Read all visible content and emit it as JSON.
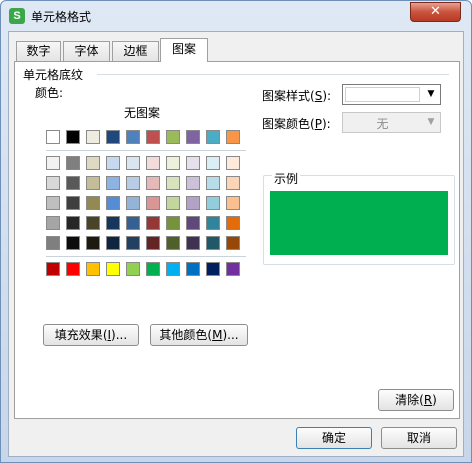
{
  "window": {
    "title": "单元格格式",
    "app_icon_letter": "S",
    "close_glyph": "✕"
  },
  "tabs": [
    {
      "label": "数字",
      "active": false
    },
    {
      "label": "字体",
      "active": false
    },
    {
      "label": "边框",
      "active": false
    },
    {
      "label": "图案",
      "active": true
    }
  ],
  "shading": {
    "group_label": "单元格底纹",
    "color_label": "颜色:",
    "no_pattern": "无图案",
    "palette_rows": [
      [
        "#ffffff",
        "#000000",
        "#eeece1",
        "#1f497d",
        "#4f81bd",
        "#c0504d",
        "#9bbb59",
        "#8064a2",
        "#4bacc6",
        "#f79646"
      ],
      [
        "#f2f2f2",
        "#7f7f7f",
        "#ddd9c3",
        "#c6d9f0",
        "#dbe5f1",
        "#f2dcdb",
        "#ebf1dd",
        "#e5e0ec",
        "#dbeef3",
        "#fdeada"
      ],
      [
        "#d8d8d8",
        "#595959",
        "#c4bd97",
        "#8db3e2",
        "#b8cce4",
        "#e5b9b7",
        "#d7e3bc",
        "#ccc1d9",
        "#b7dde8",
        "#fbd5b5"
      ],
      [
        "#bfbfbf",
        "#3f3f3f",
        "#938953",
        "#548dd4",
        "#95b3d7",
        "#d99694",
        "#c3d69b",
        "#b2a2c7",
        "#92cddc",
        "#fac08f"
      ],
      [
        "#a5a5a5",
        "#262626",
        "#494429",
        "#17365d",
        "#366092",
        "#953734",
        "#76923c",
        "#5f497a",
        "#31859b",
        "#e36c09"
      ],
      [
        "#7f7f7f",
        "#0c0c0c",
        "#1d1b10",
        "#0f243e",
        "#244061",
        "#632423",
        "#4f6128",
        "#3f3151",
        "#205867",
        "#974806"
      ]
    ],
    "standard_colors": [
      "#c00000",
      "#ff0000",
      "#ffc000",
      "#ffff00",
      "#92d050",
      "#00b050",
      "#00b0f0",
      "#0070c0",
      "#002060",
      "#7030a0"
    ],
    "selected_color": "#00b050",
    "fill_effects_button": {
      "label": "填充效果",
      "accel": "I",
      "suffix": "..."
    },
    "more_colors_button": {
      "label": "其他颜色",
      "accel": "M",
      "suffix": "..."
    }
  },
  "pattern_style": {
    "label": "图案样式",
    "accel": "S",
    "value": ""
  },
  "pattern_color": {
    "label": "图案颜色",
    "accel": "P",
    "value": "无",
    "disabled": true
  },
  "sample": {
    "label": "示例",
    "fill_color": "#00b050"
  },
  "clear_button": {
    "label": "清除",
    "accel": "R"
  },
  "ok_button": {
    "label": "确定"
  },
  "cancel_button": {
    "label": "取消"
  }
}
